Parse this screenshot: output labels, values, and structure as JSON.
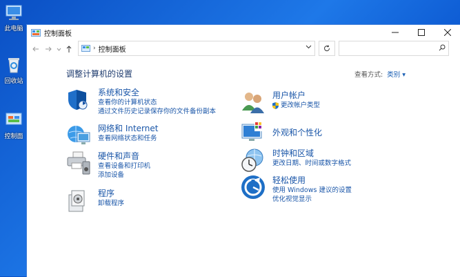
{
  "desktop": {
    "icons": [
      {
        "label": "此电脑"
      },
      {
        "label": "回收站"
      },
      {
        "label": "控制面"
      }
    ]
  },
  "window": {
    "title": "控制面板",
    "address": {
      "crumb": "控制面板",
      "separator": "›"
    },
    "search": {
      "placeholder": ""
    }
  },
  "content": {
    "heading": "调整计算机的设置",
    "view_by": {
      "label": "查看方式:",
      "value": "类别 ▾"
    },
    "left": [
      {
        "title": "系统和安全",
        "links": [
          "查看你的计算机状态",
          "通过文件历史记录保存你的文件备份副本"
        ]
      },
      {
        "title": "网络和 Internet",
        "links": [
          "查看网络状态和任务"
        ]
      },
      {
        "title": "硬件和声音",
        "links": [
          "查看设备和打印机",
          "添加设备"
        ]
      },
      {
        "title": "程序",
        "links": [
          "卸载程序"
        ]
      }
    ],
    "right": [
      {
        "title": "用户帐户",
        "links": [
          "更改帐户类型"
        ]
      },
      {
        "title": "外观和个性化",
        "links": []
      },
      {
        "title": "时钟和区域",
        "links": [
          "更改日期、时间或数字格式"
        ]
      },
      {
        "title": "轻松使用",
        "links": [
          "使用 Windows 建议的设置",
          "优化视觉显示"
        ]
      }
    ]
  },
  "colors": {
    "link": "#1a56a8",
    "heading": "#1e3b6e",
    "accent": "#0b57d0"
  }
}
